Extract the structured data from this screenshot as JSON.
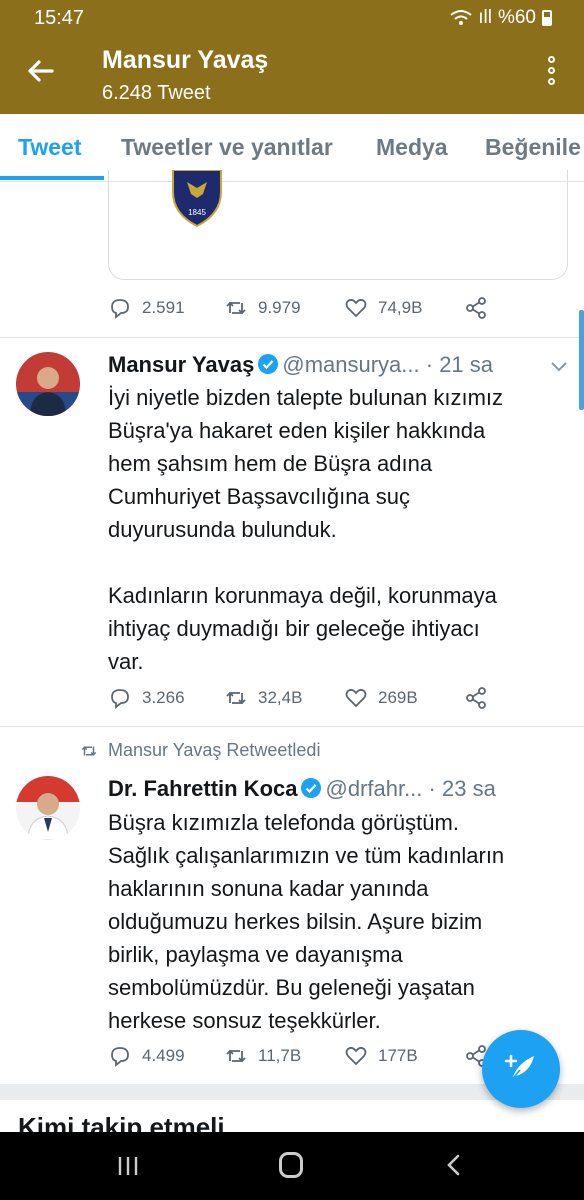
{
  "status_bar": {
    "time": "15:47",
    "signal": "ıll",
    "battery": "%60"
  },
  "header": {
    "title": "Mansur Yavaş",
    "subtitle": "6.248 Tweet",
    "back_icon": "arrow-left-icon",
    "more_icon": "vertical-dots-icon"
  },
  "tabs": [
    {
      "label": "Tweet",
      "active": true
    },
    {
      "label": "Tweetler ve yanıtlar",
      "active": false
    },
    {
      "label": "Medya",
      "active": false
    },
    {
      "label": "Beğenile",
      "active": false
    }
  ],
  "prev_tweet": {
    "crest_text": "1845",
    "actions": {
      "replies": "2.591",
      "retweets": "9.979",
      "likes": "74,9B"
    }
  },
  "tweet1": {
    "name": "Mansur Yavaş",
    "handle": "@mansurya...",
    "time": "· 21 sa",
    "lines": [
      "İyi niyetle bizden talepte bulunan kızımız",
      "Büşra'ya hakaret eden kişiler hakkında",
      "hem şahsım hem de Büşra adına",
      "Cumhuriyet Başsavcılığına suç",
      "duyurusunda bulunduk.",
      "",
      "Kadınların korunmaya değil, korunmaya",
      "ihtiyaç duymadığı bir geleceğe ihtiyacı",
      "var."
    ],
    "actions": {
      "replies": "3.266",
      "retweets": "32,4B",
      "likes": "269B"
    }
  },
  "retweet_label": "Mansur Yavaş Retweetledi",
  "tweet2": {
    "name": "Dr. Fahrettin Koca",
    "handle": "@drfahr...",
    "time": "· 23 sa",
    "lines": [
      "Büşra kızımızla telefonda görüştüm.",
      "Sağlık çalışanlarımızın ve tüm kadınların",
      "haklarının sonuna kadar yanında",
      "olduğumuzu herkes bilsin. Aşure bizim",
      "birlik, paylaşma ve dayanışma",
      "sembolümüzdür. Bu geleneği yaşatan",
      "herkese sonsuz teşekkürler."
    ],
    "actions": {
      "replies": "4.499",
      "retweets": "11,7B",
      "likes": "177B"
    }
  },
  "who_to_follow": "Kimi takip etmeli",
  "colors": {
    "header": "#8b6f1a",
    "accent": "#1da1f2"
  }
}
